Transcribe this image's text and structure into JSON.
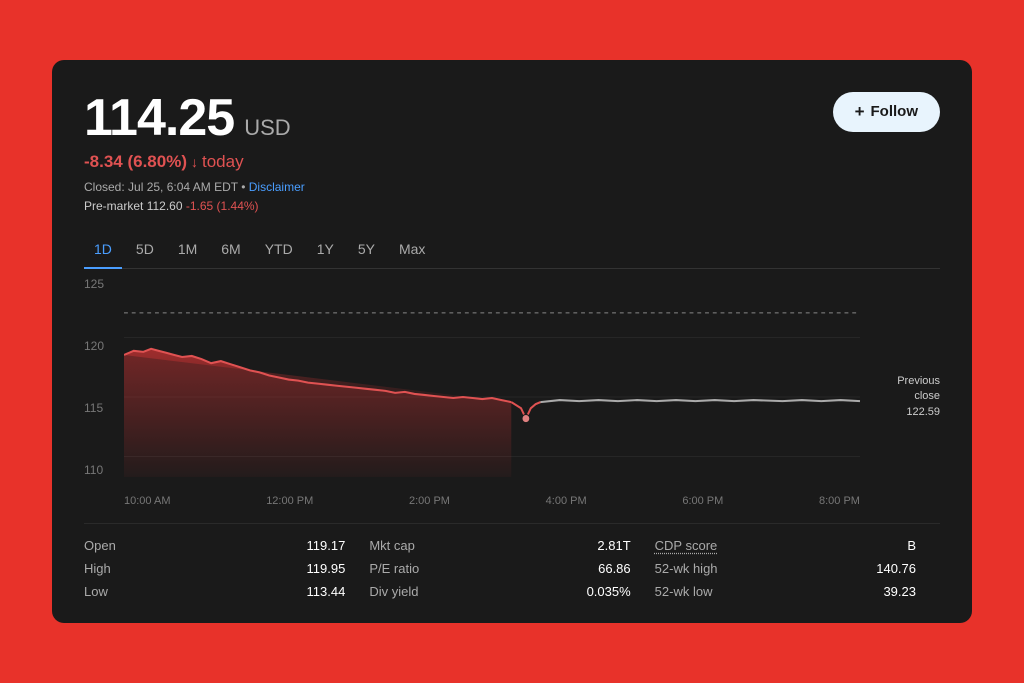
{
  "price": {
    "value": "114.25",
    "currency": "USD",
    "change": "-8.34 (6.80%)",
    "change_arrow": "↓",
    "today_label": "today",
    "closed_line": "Closed: Jul 25, 6:04 AM EDT",
    "disclaimer_label": "Disclaimer",
    "premarket_label": "Pre-market",
    "premarket_value": "112.60",
    "premarket_change": "-1.65 (1.44%)"
  },
  "follow_button": {
    "plus": "+",
    "label": "Follow"
  },
  "time_tabs": [
    {
      "label": "1D",
      "active": true
    },
    {
      "label": "5D",
      "active": false
    },
    {
      "label": "1M",
      "active": false
    },
    {
      "label": "6M",
      "active": false
    },
    {
      "label": "YTD",
      "active": false
    },
    {
      "label": "1Y",
      "active": false
    },
    {
      "label": "5Y",
      "active": false
    },
    {
      "label": "Max",
      "active": false
    }
  ],
  "chart": {
    "y_labels": [
      "125",
      "120",
      "115",
      "110"
    ],
    "x_labels": [
      "10:00 AM",
      "12:00 PM",
      "2:00 PM",
      "4:00 PM",
      "6:00 PM",
      "8:00 PM"
    ],
    "previous_close": "Previous\nclose\n122.59"
  },
  "stats": {
    "col1": [
      {
        "label": "Open",
        "value": "119.17"
      },
      {
        "label": "High",
        "value": "119.95"
      },
      {
        "label": "Low",
        "value": "113.44"
      }
    ],
    "col2": [
      {
        "label": "Mkt cap",
        "value": "2.81T"
      },
      {
        "label": "P/E ratio",
        "value": "66.86"
      },
      {
        "label": "Div yield",
        "value": "0.035%"
      }
    ],
    "col3": [
      {
        "label": "CDP score",
        "value": "B",
        "underline": true
      },
      {
        "label": "52-wk high",
        "value": "140.76"
      },
      {
        "label": "52-wk low",
        "value": "39.23"
      }
    ]
  }
}
